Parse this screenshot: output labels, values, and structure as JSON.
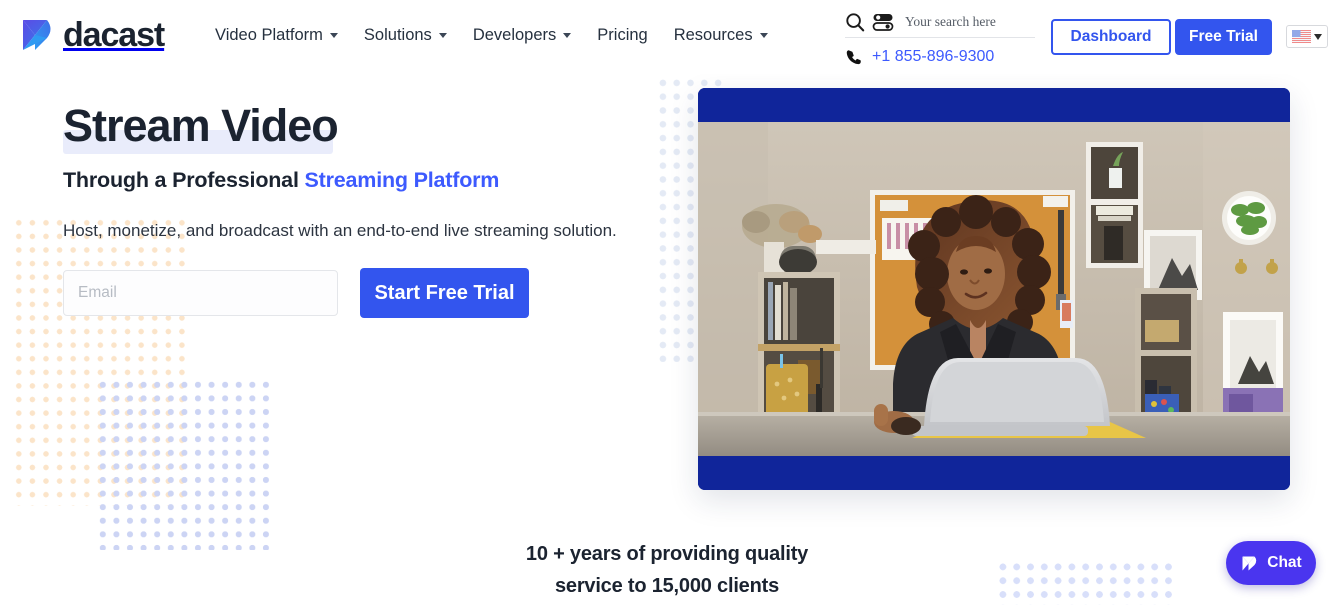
{
  "brand": {
    "name": "dacast",
    "logo_icon": "dacast-arrow-logo",
    "accent_blue": "#3355ee",
    "link_blue": "#3d5afe",
    "player_navy": "#10259a",
    "chat_purple": "#4a35ef",
    "heading_ink": "#1b2330",
    "highlight_lavender": "#e9ecfb",
    "dots_peach": "#fbe3c6",
    "dots_blue": "#ccd4f4"
  },
  "header": {
    "nav": [
      {
        "label": "Video Platform",
        "has_dropdown": true
      },
      {
        "label": "Solutions",
        "has_dropdown": true
      },
      {
        "label": "Developers",
        "has_dropdown": true
      },
      {
        "label": "Pricing",
        "has_dropdown": false
      },
      {
        "label": "Resources",
        "has_dropdown": true
      }
    ],
    "search": {
      "icon": "search-icon",
      "filter_icon": "sliders-icon",
      "placeholder": "Your search here",
      "value": ""
    },
    "phone": {
      "icon": "phone-icon",
      "number": "+1 855-896-9300"
    },
    "dashboard_label": "Dashboard",
    "free_trial_label": "Free Trial",
    "language": {
      "flag_icon": "us-flag-icon",
      "caret_icon": "chevron-down-icon"
    }
  },
  "hero": {
    "title": "Stream Video",
    "subtitle_lead": "Through a Professional ",
    "subtitle_accent": "Streaming Platform",
    "lede": "Host, monetize, and broadcast with an end-to-end live streaming solution.",
    "form": {
      "email_placeholder": "Email",
      "email_value": "",
      "submit_label": "Start Free Trial"
    }
  },
  "player": {
    "name": "video-player",
    "scene": "woman-with-curly-hair-at-desk-using-laptop-in-office"
  },
  "stats": {
    "line1": "10 + years of providing quality",
    "line2": "service to 15,000 clients"
  },
  "chat": {
    "label": "Chat",
    "icon": "dacast-arrow-logo"
  }
}
